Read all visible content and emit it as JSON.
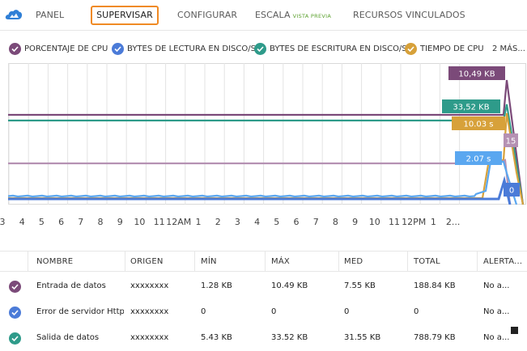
{
  "nav": {
    "tabs": [
      {
        "label": "PANEL"
      },
      {
        "label": "SUPERVISAR"
      },
      {
        "label": "CONFIGURAR"
      },
      {
        "label": "ESCALA",
        "badge": "VISTA PREVIA"
      },
      {
        "label": "RECURSOS VINCULADOS"
      }
    ],
    "active_tab": "SUPERVISAR",
    "logo_icon": "cloud-service-icon"
  },
  "legend": {
    "items": [
      {
        "label": "PORCENTAJE DE CPU",
        "color": "#7b4a79",
        "icon": "checkmark-icon"
      },
      {
        "label": "BYTES DE LECTURA EN DISCO/S",
        "color": "#4b7bd8",
        "icon": "checkmark-icon"
      },
      {
        "label": "BYTES DE ESCRITURA EN DISCO/S",
        "color": "#2e9b8a",
        "icon": "checkmark-icon"
      },
      {
        "label": "TIEMPO DE CPU",
        "color": "#d7a13a",
        "icon": "checkmark-icon"
      }
    ],
    "more": "2 MÁS..."
  },
  "chart_data": {
    "type": "line",
    "x_ticks": [
      "3",
      "4",
      "5",
      "6",
      "7",
      "8",
      "9",
      "10",
      "11",
      "12AM",
      "1",
      "2",
      "3",
      "4",
      "5",
      "6",
      "7",
      "8",
      "9",
      "10",
      "11",
      "12PM",
      "1",
      "2..."
    ],
    "series": [
      {
        "name": "PORCENTAJE DE CPU",
        "color": "#7b4a79",
        "label": "10,49 KB"
      },
      {
        "name": "BYTES DE ESCRITURA EN DISCO/S",
        "color": "#2e9b8a",
        "label": "33,52 KB"
      },
      {
        "name": "TIEMPO DE CPU",
        "color": "#d7a13a",
        "label": "10.03 s"
      },
      {
        "color": "#b591b3",
        "label": "15"
      },
      {
        "color": "#5aa7f0",
        "label": "2.07 s"
      },
      {
        "name": "BYTES DE LECTURA EN DISCO/S",
        "color": "#4b7bd8",
        "label": "0"
      }
    ],
    "grid": true
  },
  "table": {
    "columns": [
      "NOMBRE",
      "ORIGEN",
      "MÍN",
      "MÁX",
      "MED",
      "TOTAL",
      "ALERTA..."
    ],
    "rows": [
      {
        "name": "Entrada de datos",
        "origin": "xxxxxxxx",
        "min": "1.28 KB",
        "max": "10.49 KB",
        "avg": "7.55 KB",
        "total": "188.84 KB",
        "alert": "No a...",
        "color": "#7b4a79"
      },
      {
        "name": "Error de servidor Http...",
        "origin": "xxxxxxxx",
        "min": "0",
        "max": "0",
        "avg": "0",
        "total": "0",
        "alert": "No a...",
        "color": "#4b7bd8"
      },
      {
        "name": "Salida de datos",
        "origin": "xxxxxxxx",
        "min": "5.43 KB",
        "max": "33.52 KB",
        "avg": "31.55 KB",
        "total": "788.79 KB",
        "alert": "No a...",
        "color": "#2e9b8a"
      }
    ]
  }
}
